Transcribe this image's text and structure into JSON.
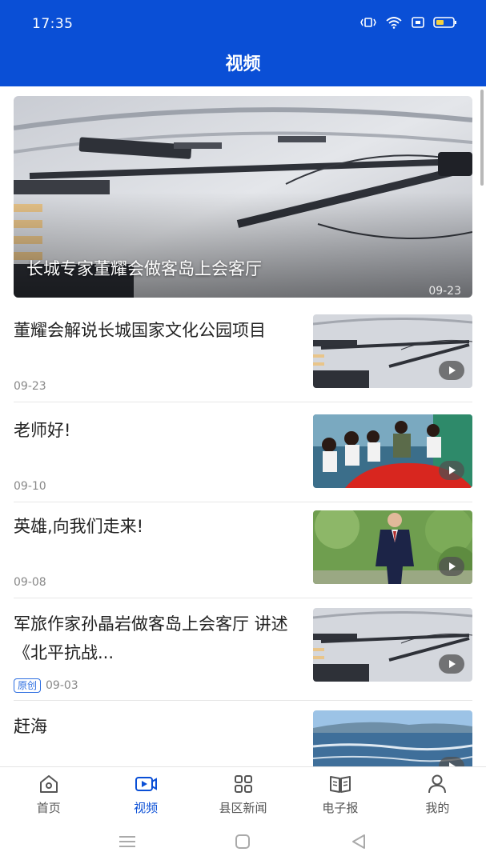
{
  "status_bar": {
    "time": "17:35"
  },
  "header": {
    "title": "视频"
  },
  "hero": {
    "caption": "长城专家董耀会做客岛上会客厅",
    "date": "09-23"
  },
  "items": [
    {
      "title": "董耀会解说长城国家文化公园项目",
      "date": "09-23",
      "badge": "",
      "thumb": "clock"
    },
    {
      "title": "老师好!",
      "date": "09-10",
      "badge": "",
      "thumb": "classroom"
    },
    {
      "title": "英雄,向我们走来!",
      "date": "09-08",
      "badge": "",
      "thumb": "man"
    },
    {
      "title": "军旅作家孙晶岩做客岛上会客厅 讲述《北平抗战...",
      "date": "09-03",
      "badge": "原创",
      "thumb": "clock"
    },
    {
      "title": "赶海",
      "date": "",
      "badge": "",
      "thumb": "sea"
    }
  ],
  "nav": [
    {
      "label": "首页",
      "icon": "home-icon"
    },
    {
      "label": "视频",
      "icon": "video-icon",
      "active": true
    },
    {
      "label": "县区新闻",
      "icon": "grid-icon"
    },
    {
      "label": "电子报",
      "icon": "newspaper-icon"
    },
    {
      "label": "我的",
      "icon": "user-icon"
    }
  ],
  "colors": {
    "brand": "#0a4fd6",
    "badge": "#2b6de0"
  }
}
